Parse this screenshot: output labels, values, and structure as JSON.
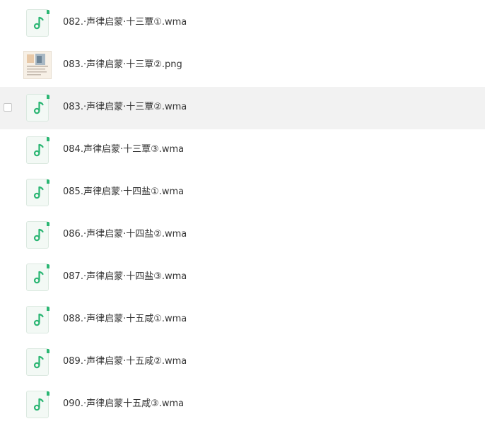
{
  "files": [
    {
      "name": "082.·声律启蒙·十三覃①.wma",
      "icon": "audio-file-icon"
    },
    {
      "name": "083.·声律启蒙·十三覃②.png",
      "icon": "image-thumbnail"
    },
    {
      "name": "083.·声律启蒙·十三覃②.wma",
      "icon": "audio-file-icon"
    },
    {
      "name": "084.声律启蒙·十三覃③.wma",
      "icon": "audio-file-icon"
    },
    {
      "name": "085.声律启蒙·十四盐①.wma",
      "icon": "audio-file-icon"
    },
    {
      "name": "086.·声律启蒙·十四盐②.wma",
      "icon": "audio-file-icon"
    },
    {
      "name": "087.·声律启蒙·十四盐③.wma",
      "icon": "audio-file-icon"
    },
    {
      "name": "088.·声律启蒙·十五咸①.wma",
      "icon": "audio-file-icon"
    },
    {
      "name": "089.·声律启蒙·十五咸②.wma",
      "icon": "audio-file-icon"
    },
    {
      "name": "090.·声律启蒙十五咸③.wma",
      "icon": "audio-file-icon"
    }
  ],
  "colors": {
    "accent_green": "#2bb673",
    "row_hover": "#f2f2f2",
    "text": "#333333"
  }
}
